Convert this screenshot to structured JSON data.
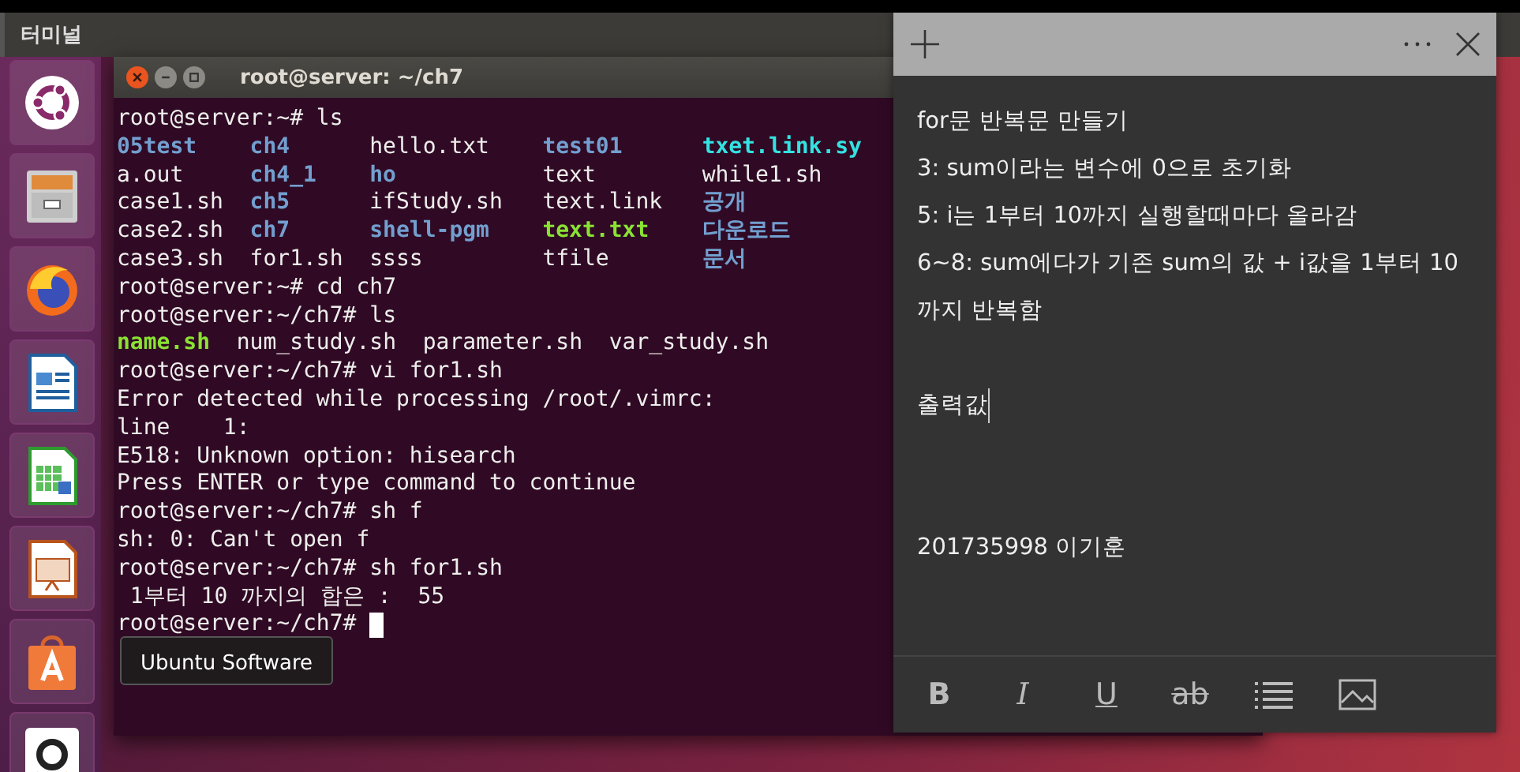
{
  "top_panel": {
    "title": "터미널"
  },
  "launcher": {
    "items": [
      {
        "kind": "dash"
      },
      {
        "kind": "files"
      },
      {
        "kind": "firefox"
      },
      {
        "kind": "writer"
      },
      {
        "kind": "calc"
      },
      {
        "kind": "impress"
      },
      {
        "kind": "software",
        "tooltip": "Ubuntu Software"
      },
      {
        "kind": "amazon"
      }
    ]
  },
  "terminal": {
    "title": "root@server: ~/ch7",
    "cursor": true,
    "lines": [
      {
        "kind": "text",
        "segments": [
          {
            "text": "root@server:~# ls",
            "kind": "plain"
          }
        ]
      },
      {
        "kind": "ls_row",
        "cells": [
          {
            "text": "05test",
            "kind": "dir"
          },
          {
            "text": "ch4",
            "kind": "dir"
          },
          {
            "text": "hello.txt",
            "kind": "plain"
          },
          {
            "text": "test01",
            "kind": "dir"
          },
          {
            "text": "txet.link.sy",
            "kind": "link"
          }
        ]
      },
      {
        "kind": "ls_row",
        "cells": [
          {
            "text": "a.out",
            "kind": "plain"
          },
          {
            "text": "ch4_1",
            "kind": "dir"
          },
          {
            "text": "ho",
            "kind": "dir"
          },
          {
            "text": "text",
            "kind": "plain"
          },
          {
            "text": "while1.sh",
            "kind": "plain"
          }
        ]
      },
      {
        "kind": "ls_row",
        "cells": [
          {
            "text": "case1.sh",
            "kind": "plain"
          },
          {
            "text": "ch5",
            "kind": "dir"
          },
          {
            "text": "ifStudy.sh",
            "kind": "plain"
          },
          {
            "text": "text.link",
            "kind": "plain"
          },
          {
            "text": "공개",
            "kind": "dir"
          }
        ]
      },
      {
        "kind": "ls_row",
        "cells": [
          {
            "text": "case2.sh",
            "kind": "plain"
          },
          {
            "text": "ch7",
            "kind": "dir"
          },
          {
            "text": "shell-pgm",
            "kind": "dir"
          },
          {
            "text": "text.txt",
            "kind": "exec"
          },
          {
            "text": "다운로드",
            "kind": "dir"
          }
        ]
      },
      {
        "kind": "ls_row",
        "cells": [
          {
            "text": "case3.sh",
            "kind": "plain"
          },
          {
            "text": "for1.sh",
            "kind": "plain"
          },
          {
            "text": "ssss",
            "kind": "plain"
          },
          {
            "text": "tfile",
            "kind": "plain"
          },
          {
            "text": "문서",
            "kind": "dir"
          }
        ]
      },
      {
        "kind": "text",
        "segments": [
          {
            "text": "root@server:~# cd ch7",
            "kind": "plain"
          }
        ]
      },
      {
        "kind": "text",
        "segments": [
          {
            "text": "root@server:~/ch7# ls",
            "kind": "plain"
          }
        ]
      },
      {
        "kind": "text",
        "segments": [
          {
            "text": "name.sh",
            "kind": "exec"
          },
          {
            "text": "num_study.sh",
            "kind": "plain"
          },
          {
            "text": "parameter.sh",
            "kind": "plain"
          },
          {
            "text": "var_study.sh",
            "kind": "plain"
          }
        ]
      },
      {
        "kind": "text",
        "segments": [
          {
            "text": "root@server:~/ch7# vi for1.sh",
            "kind": "plain"
          }
        ]
      },
      {
        "kind": "text",
        "segments": [
          {
            "text": "Error detected while processing /root/.vimrc:",
            "kind": "plain"
          }
        ]
      },
      {
        "kind": "text",
        "segments": [
          {
            "text": "line    1:",
            "kind": "plain"
          }
        ]
      },
      {
        "kind": "text",
        "segments": [
          {
            "text": "E518: Unknown option: hisearch",
            "kind": "plain"
          }
        ]
      },
      {
        "kind": "text",
        "segments": [
          {
            "text": "Press ENTER or type command to continue",
            "kind": "plain"
          }
        ]
      },
      {
        "kind": "text",
        "segments": [
          {
            "text": "root@server:~/ch7# sh f",
            "kind": "plain"
          }
        ]
      },
      {
        "kind": "text",
        "segments": [
          {
            "text": "sh: 0: Can't open f",
            "kind": "plain"
          }
        ]
      },
      {
        "kind": "text",
        "segments": [
          {
            "text": "root@server:~/ch7# sh for1.sh",
            "kind": "plain"
          }
        ]
      },
      {
        "kind": "text",
        "segments": [
          {
            "text": " 1부터 10 까지의 합은 :  55",
            "kind": "plain"
          }
        ]
      },
      {
        "kind": "text",
        "segments": [
          {
            "text": "root@server:~/ch7#",
            "kind": "plain"
          }
        ]
      }
    ]
  },
  "sticky_note": {
    "sections": [
      {
        "kind": "body",
        "lines": [
          {
            "text": "for문 반복문 만들기"
          },
          {
            "text": "3: sum이라는 변수에 0으로 초기화"
          },
          {
            "text": "5: i는 1부터 10까지 실행할때마다 올라감"
          },
          {
            "text": "6~8: sum에다가 기존 sum의 값 + i값을 1부터 10까지 반복함"
          }
        ]
      },
      {
        "kind": "body",
        "lines": [
          {
            "text": "출력값",
            "cursor": true
          }
        ]
      },
      {
        "kind": "signature",
        "lines": [
          {
            "text": "201735998 이기훈"
          }
        ]
      }
    ],
    "toolbar": [
      {
        "kind": "bold",
        "label": "B"
      },
      {
        "kind": "italic",
        "label": "I"
      },
      {
        "kind": "underline",
        "label": "U"
      },
      {
        "kind": "strike",
        "label": "ab"
      },
      {
        "kind": "bullets"
      },
      {
        "kind": "image"
      }
    ]
  }
}
